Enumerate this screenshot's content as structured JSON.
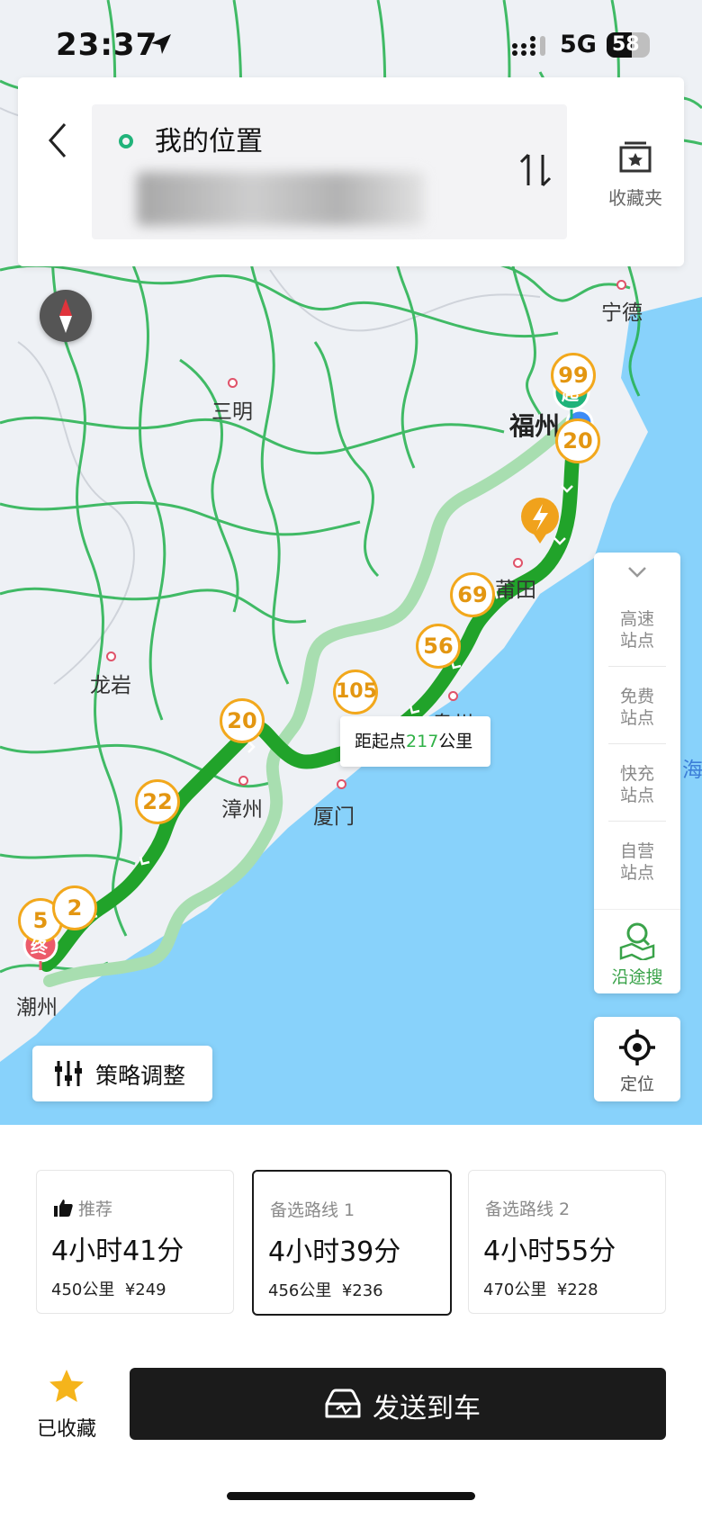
{
  "status_bar": {
    "time": "23:37",
    "network": "5G",
    "battery": "58",
    "battery_level": 0.58
  },
  "header": {
    "origin_label": "我的位置",
    "favorites_label": "收藏夹"
  },
  "map": {
    "cities": [
      "宁德",
      "三明",
      "福州",
      "莆田",
      "龙岩",
      "漳州",
      "厦门",
      "泉州",
      "潮州",
      "海"
    ],
    "road_numbers": [
      "99",
      "20",
      "69",
      "56",
      "105",
      "20",
      "22",
      "5",
      "2"
    ],
    "start_marker": "起",
    "end_marker": "终",
    "distance_label": {
      "prefix": "距起点",
      "value": "217",
      "suffix": "公里"
    },
    "route_color": "#21a32a",
    "alt_route_color": "#a8deb0",
    "water_color": "#88d2fb"
  },
  "right_panel": {
    "items": [
      {
        "line1": "高速",
        "line2": "站点"
      },
      {
        "line1": "免费",
        "line2": "站点"
      },
      {
        "line1": "快充",
        "line2": "站点"
      },
      {
        "line1": "自营",
        "line2": "站点"
      }
    ],
    "search_along_label": "沿途搜",
    "locate_label": "定位"
  },
  "strategy_label": "策略调整",
  "routes": [
    {
      "tag": "推荐",
      "duration": "4小时41分",
      "distance": "450公里",
      "cost": "¥249",
      "selected": false
    },
    {
      "tag": "备选路线 1",
      "duration": "4小时39分",
      "distance": "456公里",
      "cost": "¥236",
      "selected": true
    },
    {
      "tag": "备选路线 2",
      "duration": "4小时55分",
      "distance": "470公里",
      "cost": "¥228",
      "selected": false
    }
  ],
  "bottom": {
    "favorited_label": "已收藏",
    "send_label": "发送到车"
  }
}
